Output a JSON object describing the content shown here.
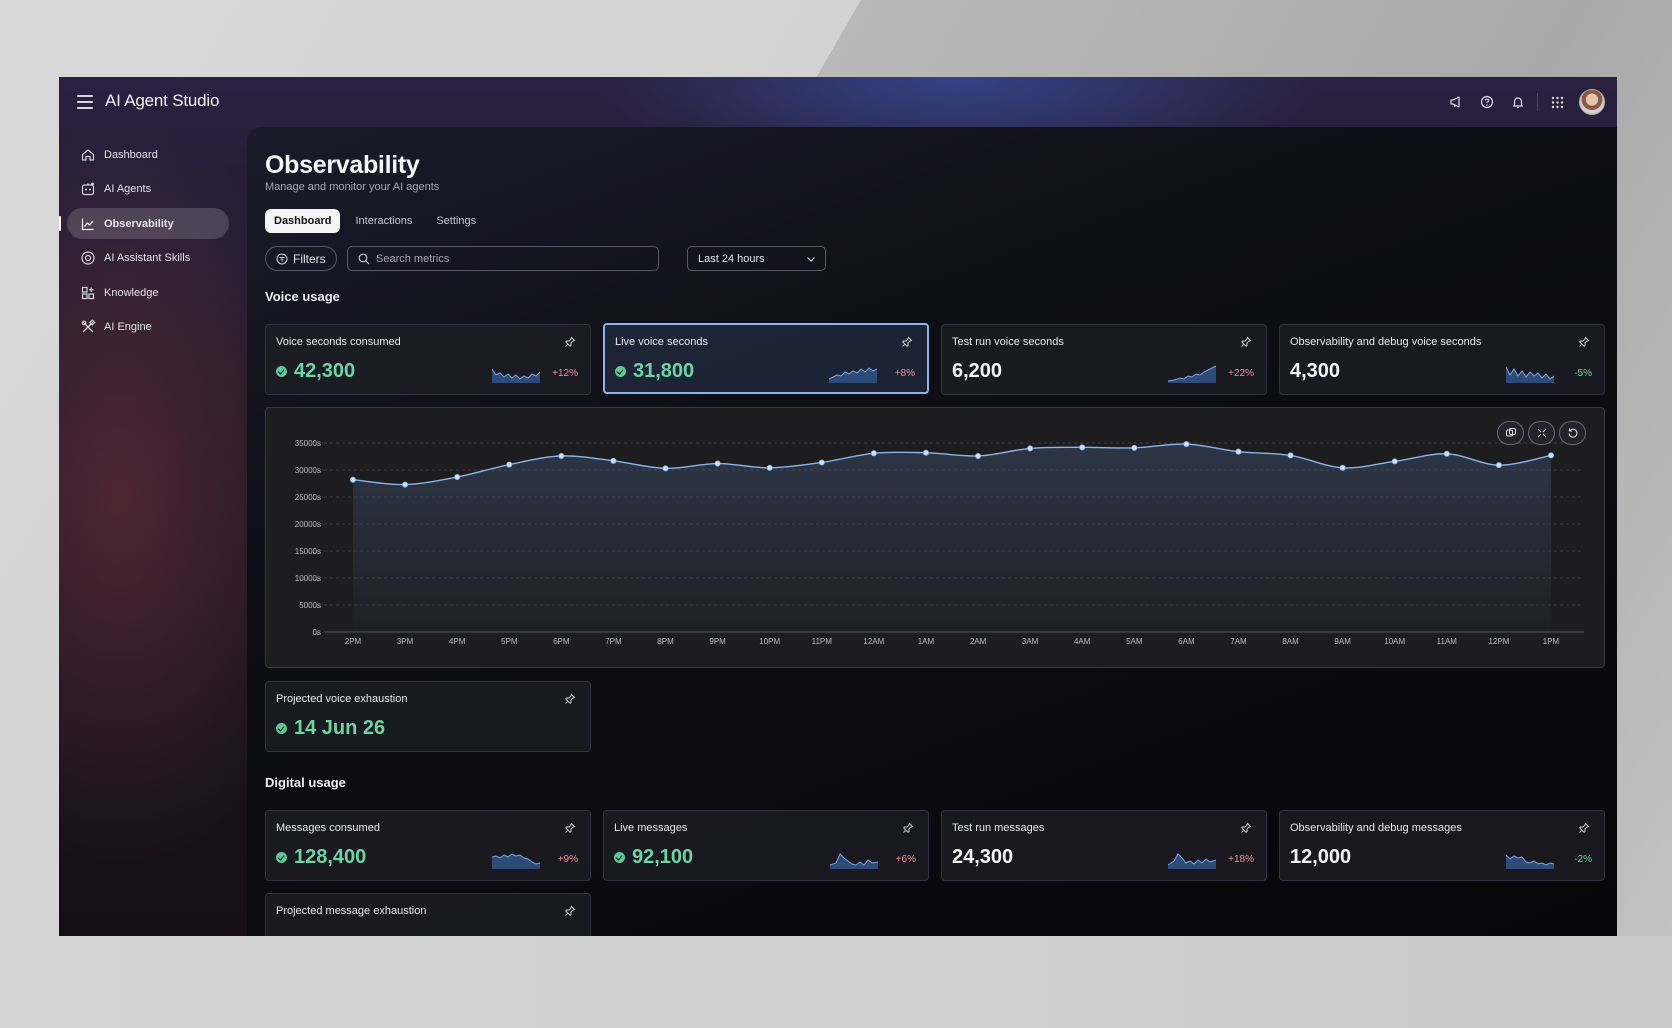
{
  "app": {
    "title": "AI Agent Studio"
  },
  "sidebar": {
    "items": [
      {
        "label": "Dashboard",
        "icon": "home-icon",
        "active": false
      },
      {
        "label": "AI Agents",
        "icon": "agent-icon",
        "active": false
      },
      {
        "label": "Observability",
        "icon": "chart-line-icon",
        "active": true
      },
      {
        "label": "AI Assistant Skills",
        "icon": "skills-icon",
        "active": false
      },
      {
        "label": "Knowledge",
        "icon": "knowledge-icon",
        "active": false
      },
      {
        "label": "AI Engine",
        "icon": "tools-icon",
        "active": false
      }
    ]
  },
  "header": {
    "title": "Observability",
    "subtitle": "Manage and monitor your AI agents",
    "tabs": [
      {
        "label": "Dashboard",
        "active": true
      },
      {
        "label": "Interactions",
        "active": false
      },
      {
        "label": "Settings",
        "active": false
      }
    ]
  },
  "toolbar": {
    "filters_label": "Filters",
    "search_placeholder": "Search metrics",
    "range_value": "Last 24 hours"
  },
  "voice": {
    "section_title": "Voice usage",
    "cards": [
      {
        "label": "Voice seconds consumed",
        "value": "42,300",
        "delta": "+12%",
        "status": "ok",
        "highlight": false
      },
      {
        "label": "Live voice seconds",
        "value": "31,800",
        "delta": "+8%",
        "status": "ok",
        "highlight": true
      },
      {
        "label": "Test run voice seconds",
        "value": "6,200",
        "delta": "+22%",
        "status": "none",
        "highlight": false
      },
      {
        "label": "Observability and debug voice seconds",
        "value": "4,300",
        "delta": "-5%",
        "status": "none",
        "highlight": false
      }
    ],
    "projected": {
      "label": "Projected voice exhaustion",
      "value": "14 Jun 26"
    }
  },
  "digital": {
    "section_title": "Digital usage",
    "cards": [
      {
        "label": "Messages consumed",
        "value": "128,400",
        "delta": "+9%",
        "status": "ok"
      },
      {
        "label": "Live messages",
        "value": "92,100",
        "delta": "+6%",
        "status": "ok"
      },
      {
        "label": "Test run messages",
        "value": "24,300",
        "delta": "+18%",
        "status": "none"
      },
      {
        "label": "Observability and debug messages",
        "value": "12,000",
        "delta": "-2%",
        "status": "none"
      }
    ],
    "projected": {
      "label": "Projected message exhaustion"
    }
  },
  "chart_data": {
    "type": "area",
    "x": [
      "2PM",
      "3PM",
      "4PM",
      "5PM",
      "6PM",
      "7PM",
      "8PM",
      "9PM",
      "10PM",
      "11PM",
      "12AM",
      "1AM",
      "2AM",
      "3AM",
      "4AM",
      "5AM",
      "6AM",
      "7AM",
      "8AM",
      "9AM",
      "10AM",
      "11AM",
      "12PM",
      "1PM"
    ],
    "series": [
      {
        "values": [
          28200,
          27300,
          28700,
          31000,
          32600,
          31700,
          30300,
          31200,
          30400,
          31400,
          33100,
          33200,
          32600,
          34000,
          34200,
          34100,
          34800,
          33400,
          32700,
          30400,
          31600,
          33000,
          30900,
          32700
        ]
      }
    ],
    "yticks": [
      "0s",
      "5000s",
      "10000s",
      "15000s",
      "20000s",
      "25000s",
      "30000s",
      "35000s"
    ],
    "ylim": [
      0,
      35000
    ],
    "grid": true,
    "colors": {
      "line": "#8bb5ea",
      "fill_top": "#3a4a66"
    }
  },
  "colors": {
    "accent": "#8fb2e8",
    "positive_status": "#5fc797",
    "delta_up": "#ef8f98",
    "delta_down": "#6fd3a4"
  }
}
